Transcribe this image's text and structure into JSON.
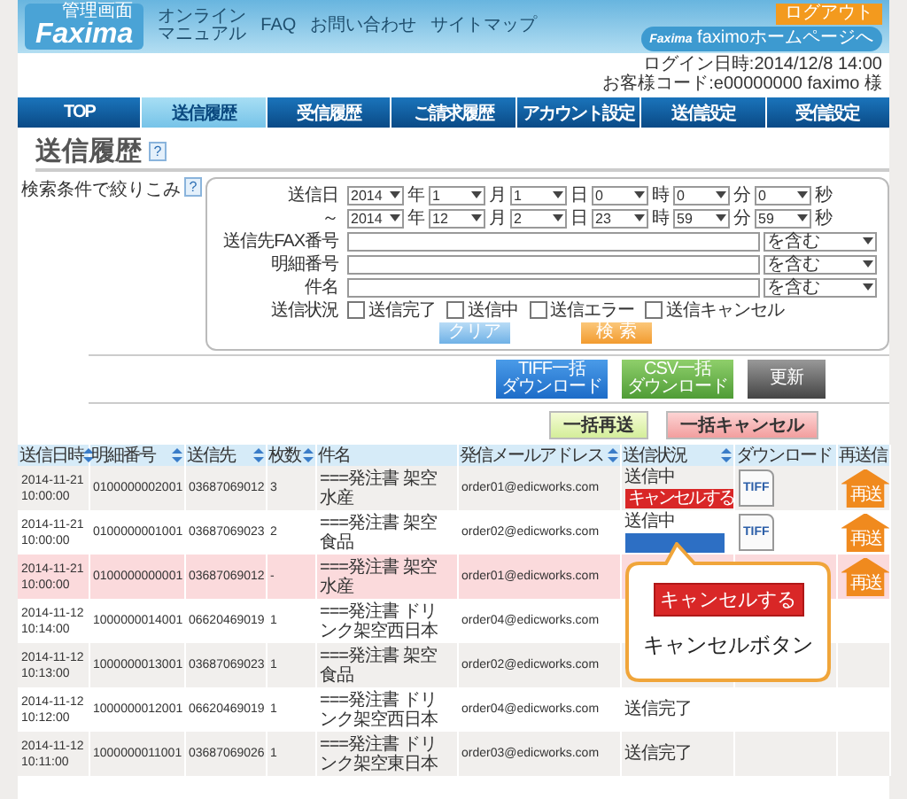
{
  "header": {
    "logo_caption": "管理画面",
    "logo": "Faxima",
    "nav": [
      {
        "lines": [
          "オンライン",
          "マニュアル"
        ]
      },
      {
        "lines": [
          "FAQ"
        ]
      },
      {
        "lines": [
          "お問い合わせ"
        ]
      },
      {
        "lines": [
          "サイトマップ"
        ]
      }
    ],
    "logout": "ログアウト",
    "homepage_logo": "Faxima",
    "homepage_link": "faximoホームページへ"
  },
  "login_info": [
    "ログイン日時:2014/12/8 14:00",
    "お客様コード:e00000000 faximo 様"
  ],
  "tabs": [
    {
      "label": "TOP",
      "selected": false
    },
    {
      "label": "送信履歴",
      "selected": true
    },
    {
      "label": "受信履歴",
      "selected": false
    },
    {
      "label": "ご請求履歴",
      "selected": false
    },
    {
      "label": "アカウント設定",
      "selected": false
    },
    {
      "label": "送信設定",
      "selected": false
    },
    {
      "label": "受信設定",
      "selected": false
    }
  ],
  "page_title": {
    "text": "送信履歴",
    "help": "?"
  },
  "filter": {
    "label": "検索条件で絞りこみ",
    "help": "?",
    "date_rows": [
      {
        "label": "送信日",
        "parts": [
          {
            "value": "2014",
            "unit": "年"
          },
          {
            "value": "1",
            "unit": "月"
          },
          {
            "value": "1",
            "unit": "日"
          },
          {
            "value": "0",
            "unit": "時"
          },
          {
            "value": "0",
            "unit": "分"
          },
          {
            "value": "0",
            "unit": "秒"
          }
        ]
      },
      {
        "label": "～",
        "parts": [
          {
            "value": "2014",
            "unit": "年"
          },
          {
            "value": "12",
            "unit": "月"
          },
          {
            "value": "2",
            "unit": "日"
          },
          {
            "value": "23",
            "unit": "時"
          },
          {
            "value": "59",
            "unit": "分"
          },
          {
            "value": "59",
            "unit": "秒"
          }
        ]
      }
    ],
    "text_filters": [
      {
        "label": "送信先FAX番号",
        "match": "を含む"
      },
      {
        "label": "明細番号",
        "match": "を含む"
      },
      {
        "label": "件名",
        "match": "を含む"
      }
    ],
    "status": {
      "label": "送信状況",
      "options": [
        {
          "label": "送信完了",
          "checked": false
        },
        {
          "label": "送信中",
          "checked": false
        },
        {
          "label": "送信エラー",
          "checked": false
        },
        {
          "label": "送信キャンセル",
          "checked": false
        }
      ]
    },
    "clear": "クリア",
    "search": "検 索"
  },
  "actions": [
    {
      "kind": "tiff",
      "lines": [
        "TIFF一括",
        "ダウンロード"
      ]
    },
    {
      "kind": "csv",
      "lines": [
        "CSV一括",
        "ダウンロード"
      ]
    },
    {
      "kind": "refresh",
      "lines": [
        "更新"
      ]
    }
  ],
  "bulk_actions": [
    {
      "kind": "resend",
      "label": "一括再送"
    },
    {
      "kind": "cancel",
      "label": "一括キャンセル"
    }
  ],
  "table": {
    "columns": [
      {
        "label": "送信日時",
        "sortable": true
      },
      {
        "label": "明細番号",
        "sortable": true
      },
      {
        "label": "送信先",
        "sortable": true
      },
      {
        "label": "枚数",
        "sortable": true
      },
      {
        "label": "件名",
        "sortable": false
      },
      {
        "label": "発信メールアドレス",
        "sortable": true
      },
      {
        "label": "送信状況",
        "sortable": true
      },
      {
        "label": "ダウンロード",
        "sortable": false
      },
      {
        "label": "再送信",
        "sortable": false
      }
    ],
    "rows": [
      {
        "date": "2014-11-21",
        "time": "10:00:00",
        "detail_no": "0100000002001",
        "destination": "03687069012",
        "pages": "3",
        "subject": "===発注書 架空水産",
        "email": "order01@edicworks.com",
        "status": "送信中",
        "badge": {
          "kind": "cancel",
          "label": "キャンセルする"
        },
        "download": "TIFF",
        "resend": "再送",
        "highlighted": false
      },
      {
        "date": "2014-11-21",
        "time": "10:00:00",
        "detail_no": "0100000001001",
        "destination": "03687069023",
        "pages": "2",
        "subject": "===発注書 架空食品",
        "email": "order02@edicworks.com",
        "status": "送信中",
        "badge": {
          "kind": "processing"
        },
        "download": "TIFF",
        "resend": "再送",
        "highlighted": false
      },
      {
        "date": "2014-11-21",
        "time": "10:00:00",
        "detail_no": "0100000000001",
        "destination": "03687069012",
        "pages": "-",
        "subject": "===発注書 架空水産",
        "email": "order01@edicworks.com",
        "resend": "再送",
        "highlighted": true
      },
      {
        "date": "2014-11-12",
        "time": "10:14:00",
        "detail_no": "1000000014001",
        "destination": "06620469019",
        "pages": "1",
        "subject": "===発注書 ドリンク架空西日本",
        "email": "order04@edicworks.com",
        "highlighted": false
      },
      {
        "date": "2014-11-12",
        "time": "10:13:00",
        "detail_no": "1000000013001",
        "destination": "03687069023",
        "pages": "1",
        "subject": "===発注書 架空食品",
        "email": "order02@edicworks.com",
        "highlighted": false
      },
      {
        "date": "2014-11-12",
        "time": "10:12:00",
        "detail_no": "1000000012001",
        "destination": "06620469019",
        "pages": "1",
        "subject": "===発注書 ドリンク架空西日本",
        "email": "order04@edicworks.com",
        "status": "送信完了",
        "highlighted": false
      },
      {
        "date": "2014-11-12",
        "time": "10:11:00",
        "detail_no": "1000000011001",
        "destination": "03687069026",
        "pages": "1",
        "subject": "===発注書 ドリンク架空東日本",
        "email": "order03@edicworks.com",
        "status": "送信完了",
        "highlighted": false
      }
    ]
  },
  "callout": {
    "button": "キャンセルする",
    "caption": "キャンセルボタン"
  }
}
